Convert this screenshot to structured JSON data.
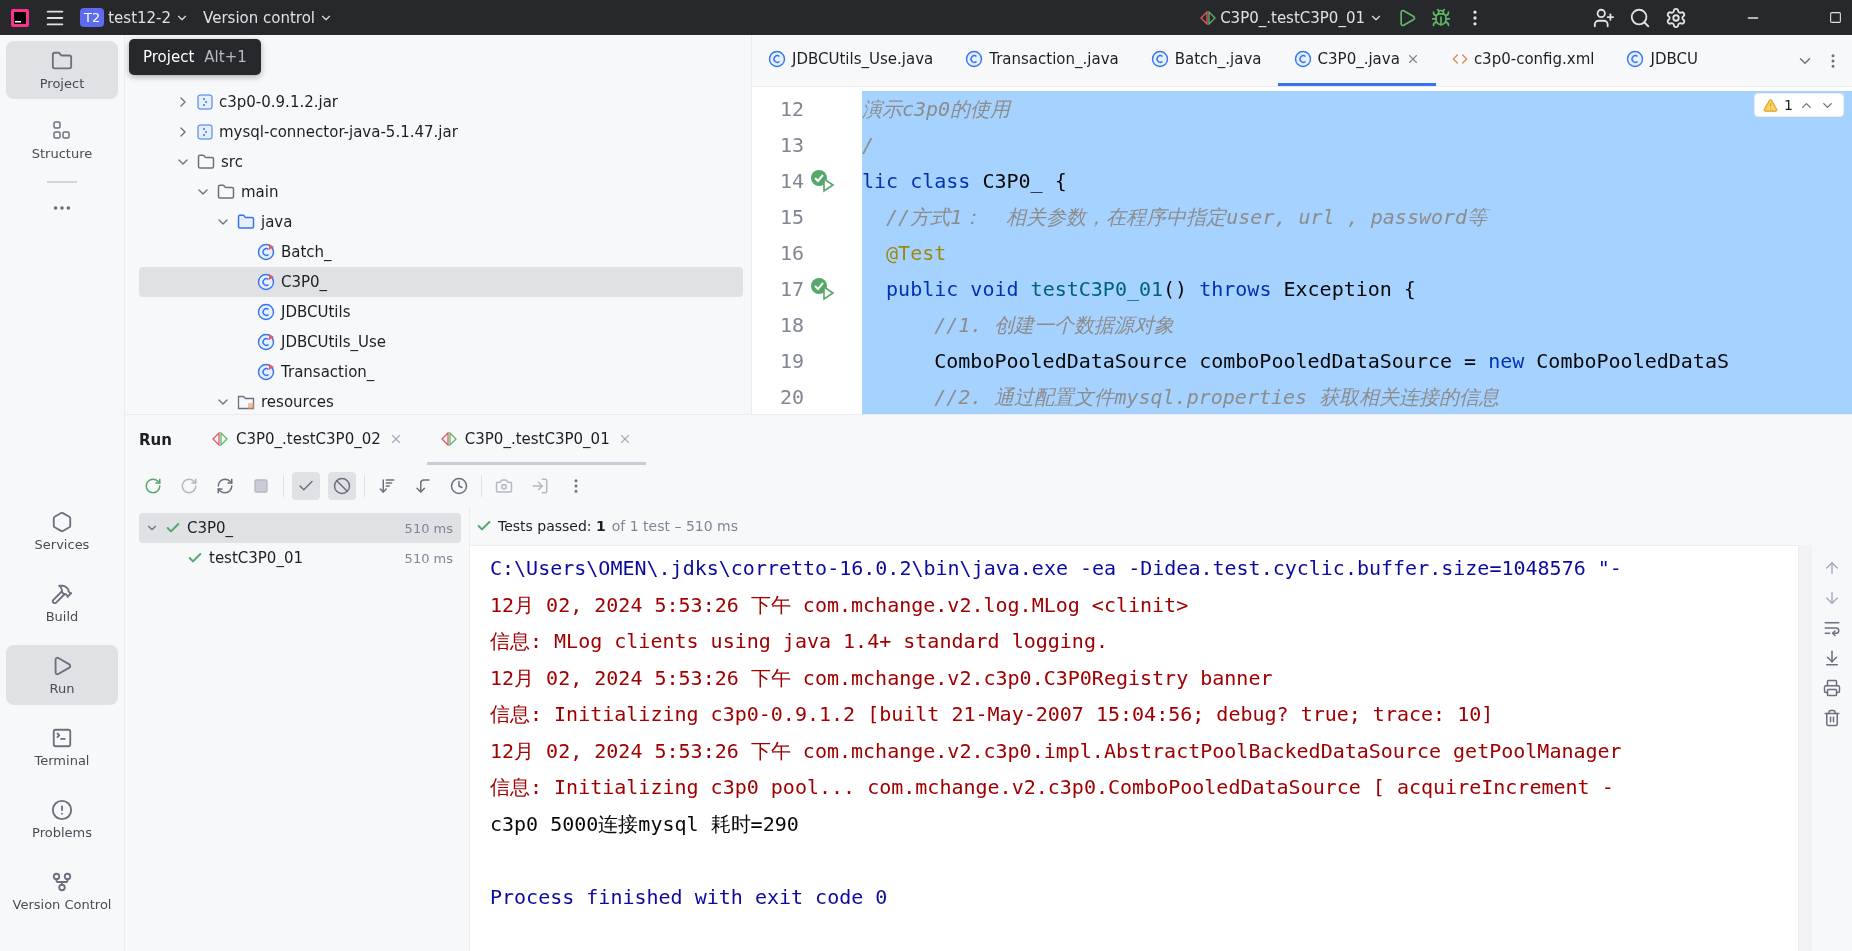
{
  "top_bar": {
    "project_badge": "T2",
    "project_name": "test12-2",
    "vcs": "Version control",
    "run_config": "C3P0_.testC3P0_01"
  },
  "sidebar": {
    "items": [
      {
        "label": "Project",
        "selected": true
      },
      {
        "label": "Structure",
        "selected": false
      },
      {
        "label": "Services",
        "selected": false
      },
      {
        "label": "Build",
        "selected": false
      },
      {
        "label": "Run",
        "selected": true
      },
      {
        "label": "Terminal",
        "selected": false
      },
      {
        "label": "Problems",
        "selected": false
      },
      {
        "label": "Version Control",
        "selected": false
      }
    ]
  },
  "tooltip": {
    "title": "Project",
    "shortcut": "Alt+1"
  },
  "project_tree": [
    {
      "label": "c3p0-0.9.1.2.jar",
      "kind": "jar",
      "expanded": false,
      "selected": false
    },
    {
      "label": "mysql-connector-java-5.1.47.jar",
      "kind": "jar",
      "expanded": false,
      "selected": false
    },
    {
      "label": "src",
      "kind": "folder",
      "expanded": true,
      "selected": false,
      "children": [
        {
          "label": "main",
          "kind": "folder",
          "expanded": true,
          "selected": false,
          "children": [
            {
              "label": "java",
              "kind": "source",
              "expanded": true,
              "selected": false,
              "children": [
                {
                  "label": "Batch_",
                  "kind": "runnable-class",
                  "selected": false
                },
                {
                  "label": "C3P0_",
                  "kind": "runnable-class",
                  "selected": true
                },
                {
                  "label": "JDBCUtils",
                  "kind": "class",
                  "selected": false
                },
                {
                  "label": "JDBCUtils_Use",
                  "kind": "runnable-class",
                  "selected": false
                },
                {
                  "label": "Transaction_",
                  "kind": "runnable-class",
                  "selected": false
                }
              ]
            },
            {
              "label": "resources",
              "kind": "resources",
              "expanded": true,
              "selected": false
            }
          ]
        }
      ]
    }
  ],
  "editor": {
    "tabs": [
      {
        "label": "JDBCUtils_Use.java",
        "kind": "class",
        "selected": false
      },
      {
        "label": "Transaction_.java",
        "kind": "class",
        "selected": false
      },
      {
        "label": "Batch_.java",
        "kind": "class",
        "selected": false
      },
      {
        "label": "C3P0_.java",
        "kind": "class",
        "selected": true
      },
      {
        "label": "c3p0-config.xml",
        "kind": "xml",
        "selected": false
      },
      {
        "label": "JDBCU",
        "kind": "class",
        "selected": false
      }
    ],
    "warnings": "1",
    "lines": [
      {
        "number": "12",
        "run_marker": false,
        "tokens": [
          {
            "text": "演示c3p0的使用",
            "kind": "comment"
          }
        ]
      },
      {
        "number": "13",
        "run_marker": false,
        "tokens": [
          {
            "text": "/",
            "kind": "comment"
          }
        ]
      },
      {
        "number": "14",
        "run_marker": true,
        "tokens": [
          {
            "text": "lic class",
            "kind": "keyword"
          },
          {
            "text": " C3P0_ {",
            "kind": "plain"
          }
        ]
      },
      {
        "number": "15",
        "run_marker": false,
        "tokens": [
          {
            "text": "  //方式1：  相关参数，在程序中指定user, url , password等",
            "kind": "comment"
          }
        ]
      },
      {
        "number": "16",
        "run_marker": false,
        "tokens": [
          {
            "text": "  @Test",
            "kind": "annotation"
          }
        ]
      },
      {
        "number": "17",
        "run_marker": true,
        "tokens": [
          {
            "text": "  public void",
            "kind": "keyword"
          },
          {
            "text": " testC3P0_01",
            "kind": "method"
          },
          {
            "text": "() ",
            "kind": "plain"
          },
          {
            "text": "throws",
            "kind": "keyword"
          },
          {
            "text": " Exception {",
            "kind": "plain"
          }
        ]
      },
      {
        "number": "18",
        "run_marker": false,
        "tokens": [
          {
            "text": "      //1. 创建一个数据源对象",
            "kind": "comment"
          }
        ]
      },
      {
        "number": "19",
        "run_marker": false,
        "tokens": [
          {
            "text": "      ComboPooledDataSource comboPooledDataSource = ",
            "kind": "plain"
          },
          {
            "text": "new",
            "kind": "keyword"
          },
          {
            "text": " ComboPooledDataS",
            "kind": "plain"
          }
        ]
      },
      {
        "number": "20",
        "run_marker": false,
        "tokens": [
          {
            "text": "      //2. 通过配置文件mysql.properties 获取相关连接的信息",
            "kind": "comment"
          }
        ]
      }
    ]
  },
  "run": {
    "title": "Run",
    "tabs": [
      {
        "label": "C3P0_.testC3P0_02",
        "selected": false
      },
      {
        "label": "C3P0_.testC3P0_01",
        "selected": true
      }
    ],
    "tree": [
      {
        "label": "C3P0_",
        "time": "510 ms",
        "passed": true,
        "expanded": true,
        "selected": true,
        "children": [
          {
            "label": "testC3P0_01",
            "time": "510 ms",
            "passed": true,
            "selected": false
          }
        ]
      }
    ],
    "summary": "Tests passed: **1**",
    "summary_detail": "of 1 test – 510 ms",
    "console": [
      {
        "text": "C:\\Users\\OMEN\\.jdks\\corretto-16.0.2\\bin\\java.exe -ea -Didea.test.cyclic.buffer.size=1048576 \"-",
        "kind": "command"
      },
      {
        "text": "12月 02, 2024 5:53:26 下午 com.mchange.v2.log.MLog <clinit>",
        "kind": "stderr"
      },
      {
        "text": "信息: MLog clients using java 1.4+ standard logging.",
        "kind": "stderr"
      },
      {
        "text": "12月 02, 2024 5:53:26 下午 com.mchange.v2.c3p0.C3P0Registry banner",
        "kind": "stderr"
      },
      {
        "text": "信息: Initializing c3p0-0.9.1.2 [built 21-May-2007 15:04:56; debug? true; trace: 10]",
        "kind": "stderr"
      },
      {
        "text": "12月 02, 2024 5:53:26 下午 com.mchange.v2.c3p0.impl.AbstractPoolBackedDataSource getPoolManager",
        "kind": "stderr"
      },
      {
        "text": "信息: Initializing c3p0 pool... com.mchange.v2.c3p0.ComboPooledDataSource [ acquireIncrement -",
        "kind": "stderr"
      },
      {
        "text": "c3p0 5000连接mysql 耗时=290",
        "kind": "stdout"
      },
      {
        "text": "Process finished with exit code 0",
        "kind": "exit"
      }
    ]
  }
}
